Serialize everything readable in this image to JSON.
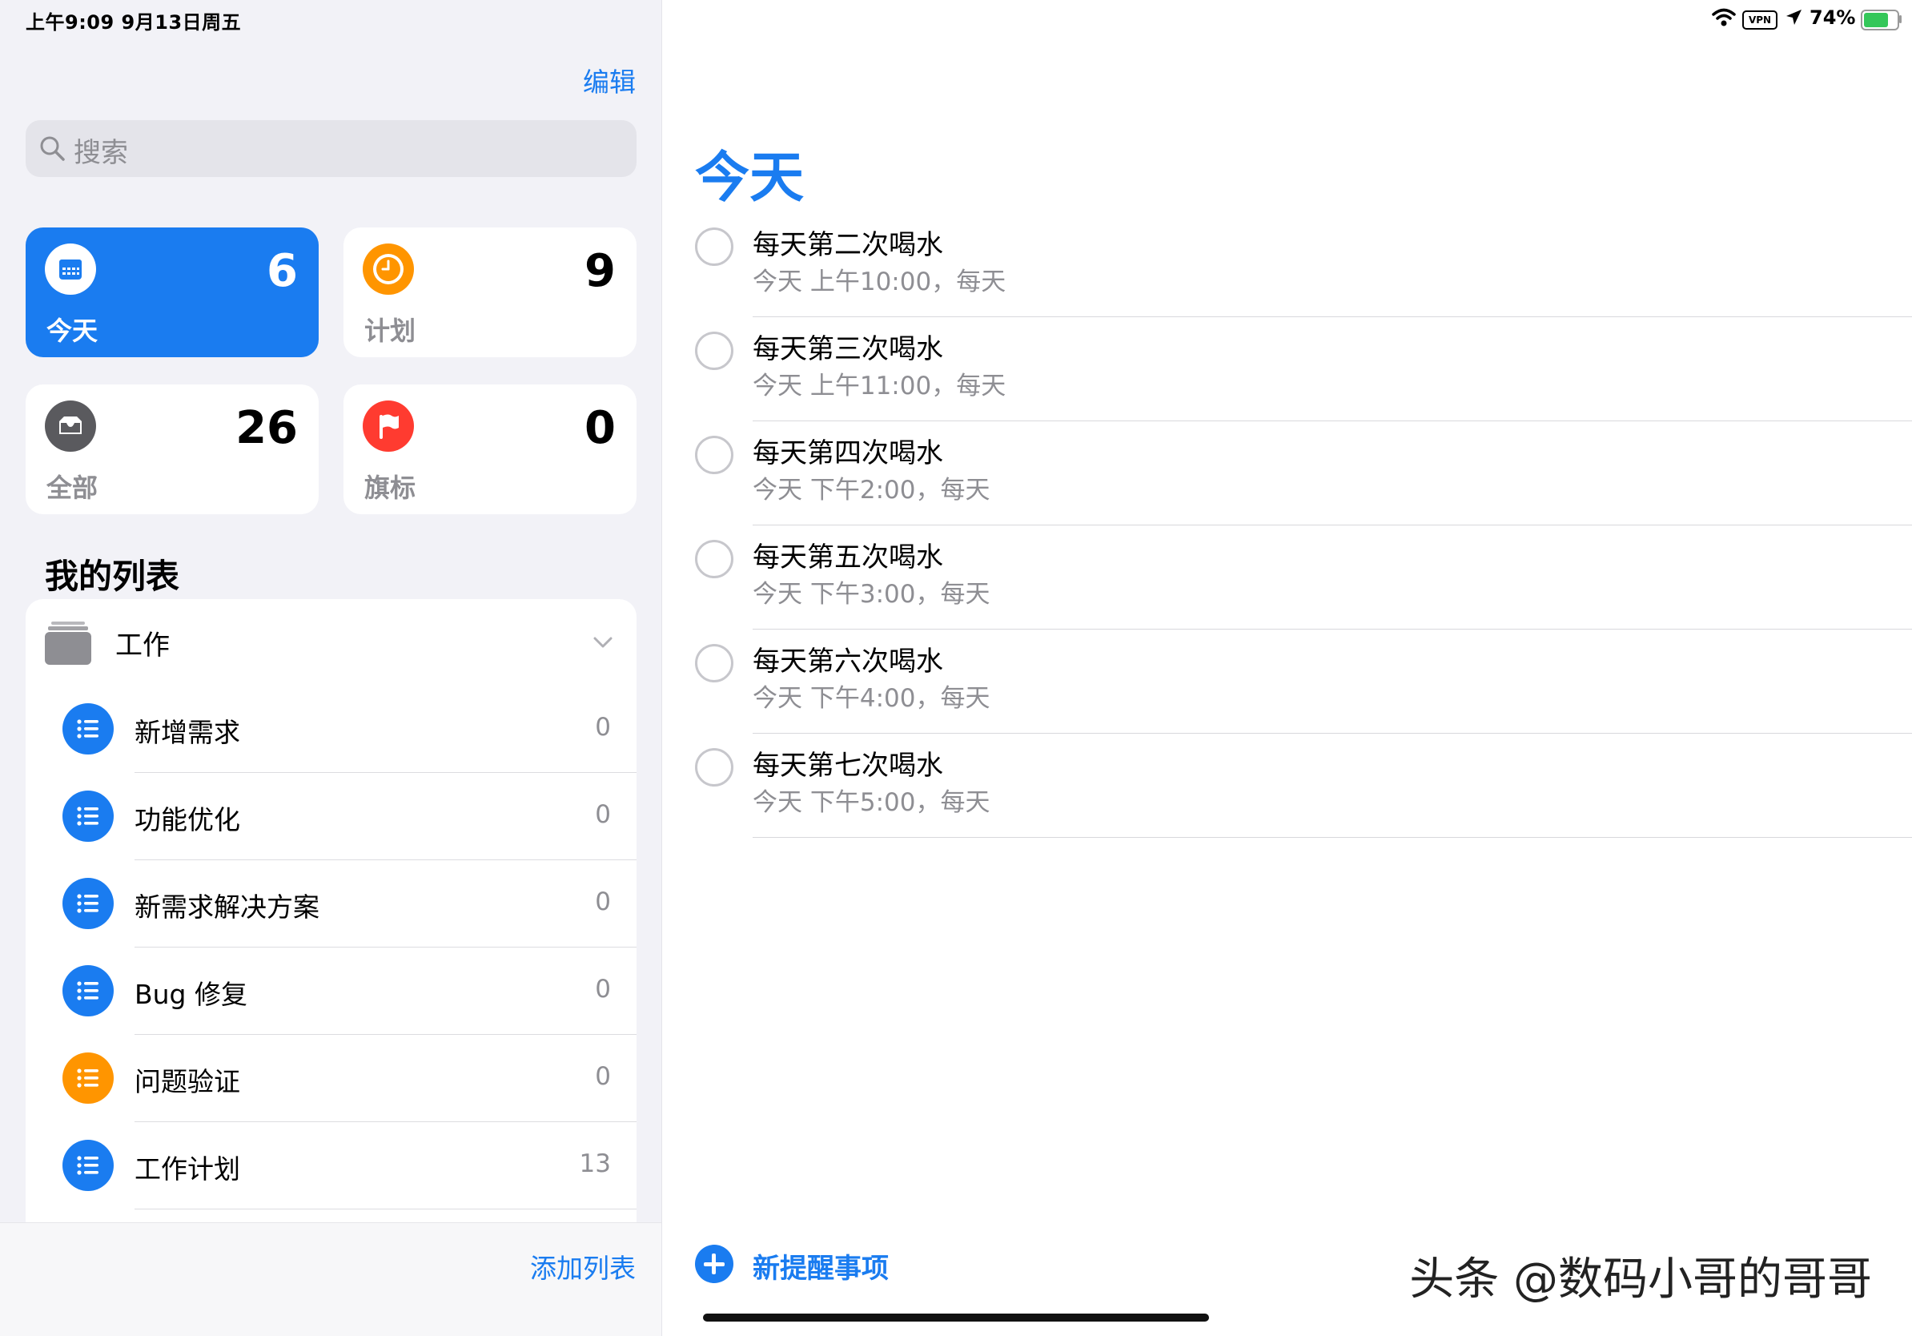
{
  "status": {
    "time": "上午9:09   9月13日周五",
    "vpn": "VPN",
    "battery_pct": "74%",
    "battery_level": 0.74
  },
  "sidebar": {
    "edit_label": "编辑",
    "search_placeholder": "搜索",
    "tiles": [
      {
        "label": "今天",
        "count": "6",
        "icon": "calendar-icon",
        "color": "#1a7cf0"
      },
      {
        "label": "计划",
        "count": "9",
        "icon": "clock-icon",
        "color": "#ff9500"
      },
      {
        "label": "全部",
        "count": "26",
        "icon": "tray-icon",
        "color": "#5a5a5e"
      },
      {
        "label": "旗标",
        "count": "0",
        "icon": "flag-icon",
        "color": "#ff3b30"
      }
    ],
    "my_lists_title": "我的列表",
    "group": {
      "label": "工作",
      "icon": "folder-icon"
    },
    "lists": [
      {
        "label": "新增需求",
        "count": "0",
        "color": "#1a7cf0"
      },
      {
        "label": "功能优化",
        "count": "0",
        "color": "#1a7cf0"
      },
      {
        "label": "新需求解决方案",
        "count": "0",
        "color": "#1a7cf0"
      },
      {
        "label": "Bug 修复",
        "count": "0",
        "color": "#1a7cf0"
      },
      {
        "label": "问题验证",
        "count": "0",
        "color": "#ff9500"
      },
      {
        "label": "工作计划",
        "count": "13",
        "color": "#1a7cf0"
      }
    ],
    "add_list_label": "添加列表"
  },
  "main": {
    "title": "今天",
    "reminders": [
      {
        "title": "每天第二次喝水",
        "subtitle": "今天 上午10:00，每天"
      },
      {
        "title": "每天第三次喝水",
        "subtitle": "今天 上午11:00，每天"
      },
      {
        "title": "每天第四次喝水",
        "subtitle": "今天 下午2:00，每天"
      },
      {
        "title": "每天第五次喝水",
        "subtitle": "今天 下午3:00，每天"
      },
      {
        "title": "每天第六次喝水",
        "subtitle": "今天 下午4:00，每天"
      },
      {
        "title": "每天第七次喝水",
        "subtitle": "今天 下午5:00，每天"
      }
    ],
    "new_reminder_label": "新提醒事项",
    "watermark": "头条 @数码小哥的哥哥"
  }
}
